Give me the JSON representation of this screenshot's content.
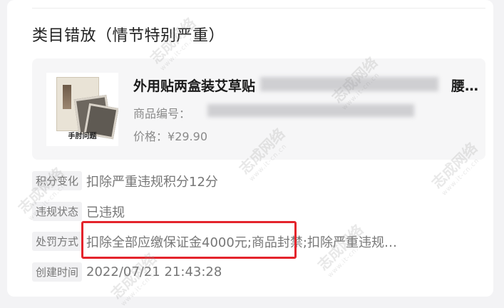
{
  "violation": {
    "title": "类目错放（情节特别严重）"
  },
  "product": {
    "thumbnail_caption": "手肘问题",
    "title_visible": "外用贴两盒装艾草贴",
    "title_tail": "腰…",
    "code_label": "商品编号：",
    "price_label": "价格：",
    "price": "¥29.90"
  },
  "details": [
    {
      "label": "积分变化",
      "value": "扣除严重违规积分12分"
    },
    {
      "label": "违规状态",
      "value": "已违规"
    },
    {
      "label": "处罚方式",
      "value": "扣除全部应缴保证金4000元;商品封禁;扣除严重违规…"
    },
    {
      "label": "创建时间",
      "value": "2022/07/21 21:43:28"
    }
  ],
  "watermark": {
    "text": "志成网络",
    "sub": "www.it-cn.cn"
  },
  "colors": {
    "highlight": "#e4242c",
    "tag_bg": "#f1f1f3",
    "card_bg": "#f6f6f7"
  }
}
